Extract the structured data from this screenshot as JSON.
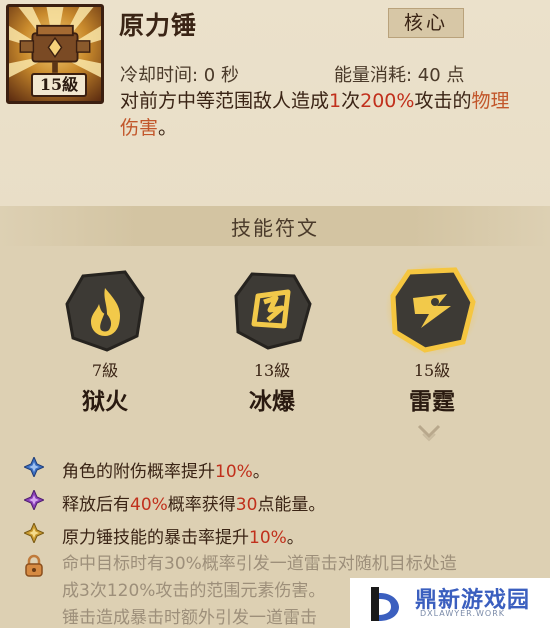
{
  "skill": {
    "level_label": "15級",
    "title": "原力锤",
    "tag": "核心",
    "cooldown": "冷却时间: 0 秒",
    "energy": "能量消耗: 40 点",
    "desc_prefix": "对前方中等范围敌人造成",
    "desc_count": "1",
    "desc_mid": "次",
    "desc_percent": "200%",
    "desc_after": "攻击的",
    "desc_type": "物理伤害",
    "desc_end": "。"
  },
  "runes": {
    "header": "技能符文",
    "items": [
      {
        "level": "7級",
        "name": "狱火",
        "icon": "flame-icon"
      },
      {
        "level": "13級",
        "name": "冰爆",
        "icon": "ice-burst-icon"
      },
      {
        "level": "15級",
        "name": "雷霆",
        "icon": "thunder-icon",
        "selected": true
      }
    ]
  },
  "bonuses": [
    {
      "icon": "blue-star-icon",
      "color": "#3b6fc2",
      "pre": "角色的附伤概率提升",
      "val": "10%",
      "post": "。"
    },
    {
      "icon": "purple-star-icon",
      "color": "#8a3fb8",
      "pre": "释放后有",
      "val": "40%",
      "mid": "概率获得",
      "val2": "30",
      "post": "点能量。"
    },
    {
      "icon": "gold-star-icon",
      "color": "#c99a2e",
      "pre": "原力锤技能的暴击率提升",
      "val": "10%",
      "post": "。"
    }
  ],
  "locked": {
    "icon": "lock-icon",
    "line1": "命中目标时有30%概率引发一道雷击对随机目标处造",
    "line2": "成3次120%攻击的范围元素伤害。",
    "line3": "锤击造成暴击时额外引发一道雷击"
  },
  "watermark": {
    "main": "鼎新游戏园",
    "sub": "DXLAWYER.WORK"
  },
  "colors": {
    "accent_red": "#c1301c",
    "selected_glow": "#f5c640",
    "rune_stone": "#3d3a35"
  }
}
